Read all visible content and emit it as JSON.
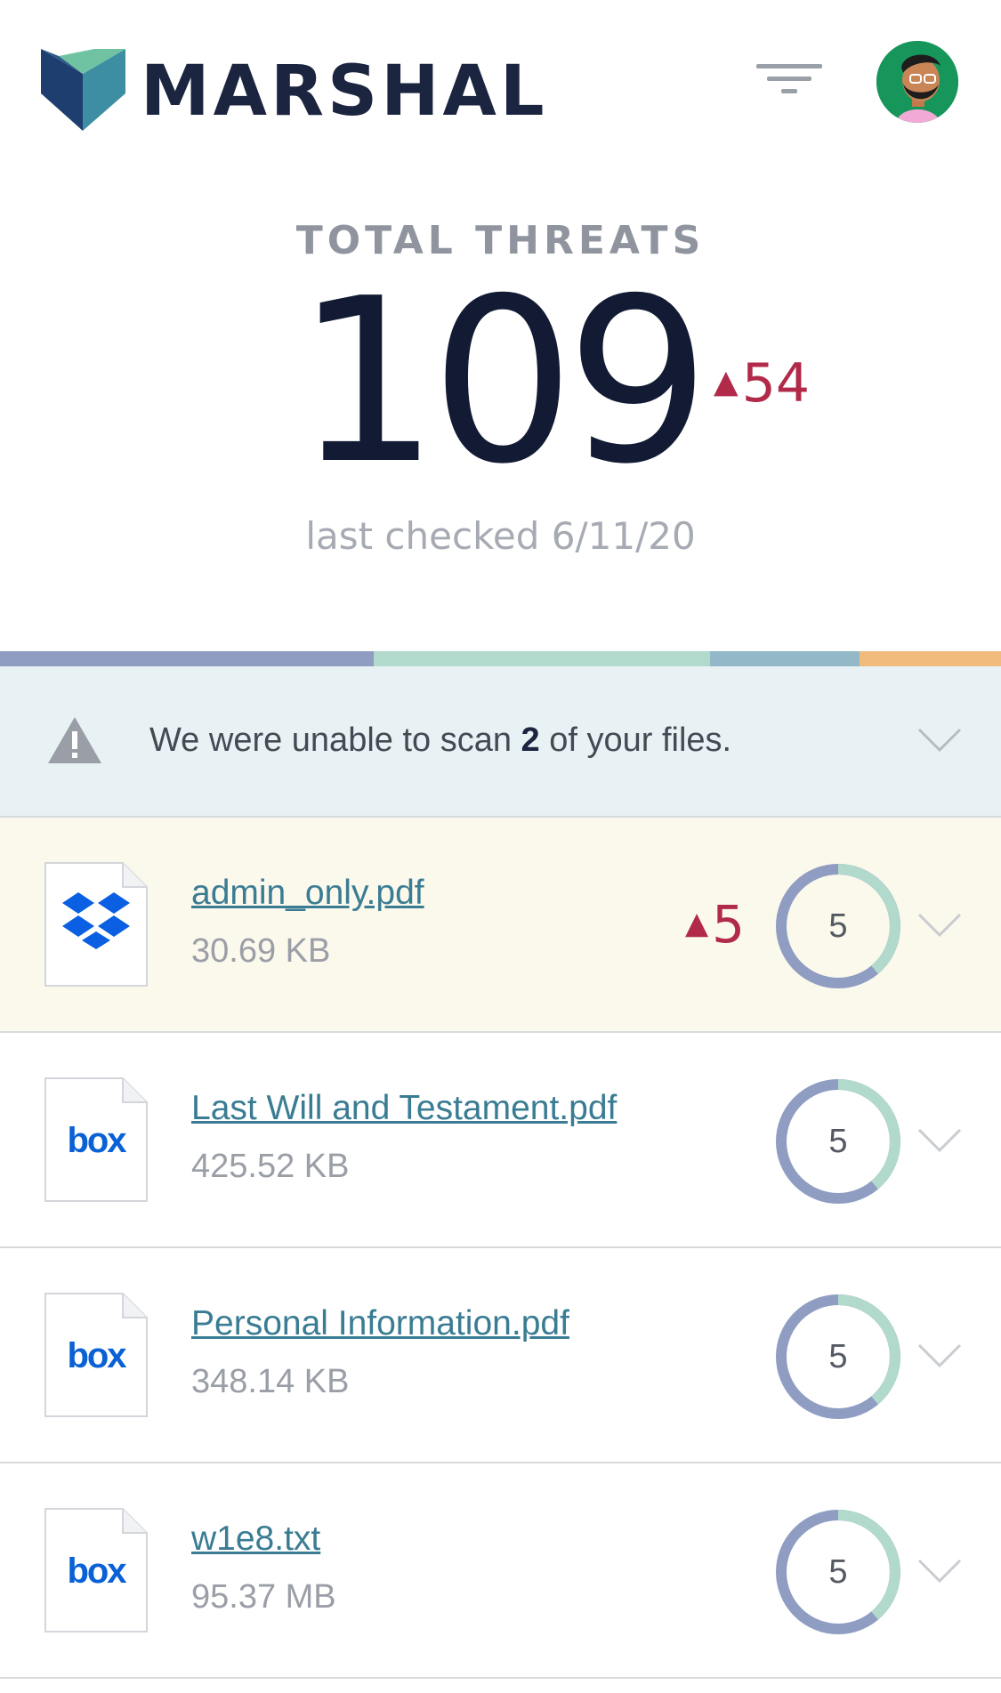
{
  "header": {
    "brand": "MARSHAL",
    "filter_icon": "filter-icon",
    "avatar_icon": "user-avatar"
  },
  "summary": {
    "label": "TOTAL THREATS",
    "count": "109",
    "delta": "54",
    "last_checked": "last checked 6/11/20"
  },
  "colors": {
    "threat_red": "#b12a4a",
    "link": "#3a7c93",
    "ring_primary": "#8f9dc2",
    "ring_secondary": "#b1d9cc",
    "bar": [
      "#8f9dc2",
      "#b1d9cc",
      "#93b9c9",
      "#f0bc7e"
    ]
  },
  "warning": {
    "prefix": "We were unable to scan ",
    "count": "2",
    "suffix": " of your files."
  },
  "files": [
    {
      "name": "admin_only.pdf",
      "size": "30.69 KB",
      "source": "dropbox",
      "delta": "5",
      "score": "5"
    },
    {
      "name": "Last Will and Testament.pdf",
      "size": "425.52 KB",
      "source": "box",
      "score": "5"
    },
    {
      "name": "Personal Information.pdf",
      "size": "348.14 KB",
      "source": "box",
      "score": "5"
    },
    {
      "name": "w1e8.txt",
      "size": "95.37 MB",
      "source": "box",
      "score": "5"
    }
  ]
}
